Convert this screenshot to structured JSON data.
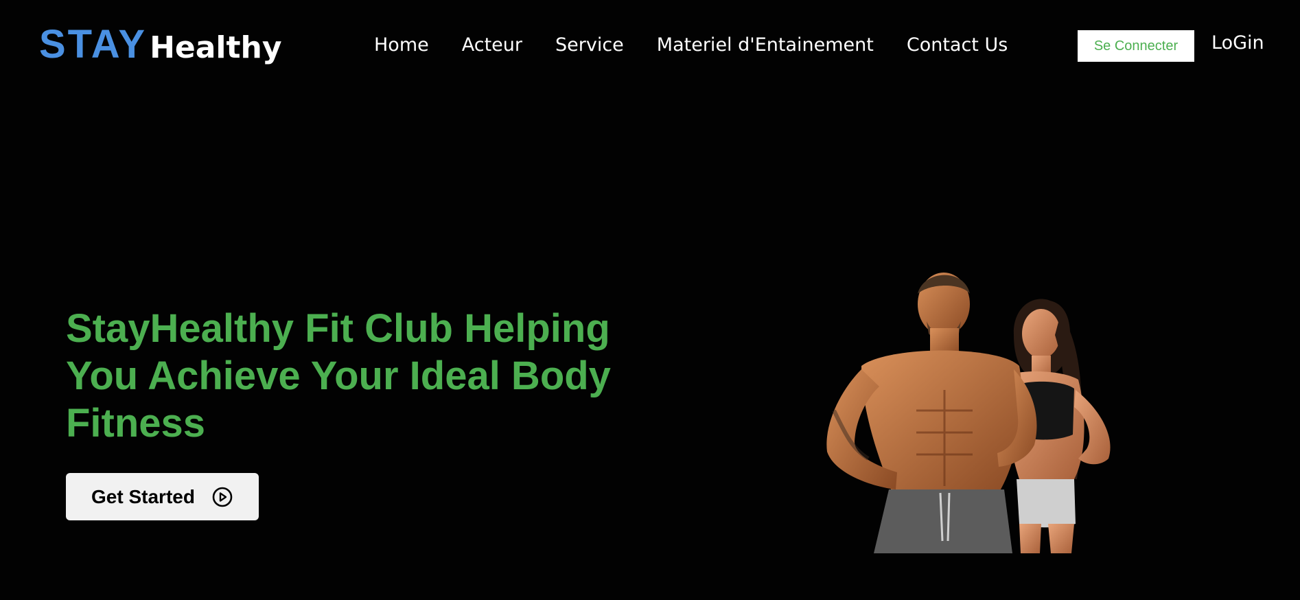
{
  "header": {
    "logo": {
      "part1": "STAY",
      "part2": "Healthy"
    },
    "nav": [
      {
        "label": "Home"
      },
      {
        "label": "Acteur"
      },
      {
        "label": "Service"
      },
      {
        "label": "Materiel d'Entainement"
      },
      {
        "label": "Contact Us"
      }
    ],
    "connect_label": "Se Connecter",
    "login_label": "LoGin"
  },
  "hero": {
    "title": "StayHealthy Fit Club Helping You Achieve Your Ideal Body Fitness",
    "cta_label": "Get Started",
    "cta_icon": "play-circle-icon",
    "image": "fitness-couple-photo"
  },
  "colors": {
    "background": "#020202",
    "logo_blue": "#4a90e2",
    "accent_green": "#4caf50",
    "button_bg": "#f1f1f1"
  }
}
